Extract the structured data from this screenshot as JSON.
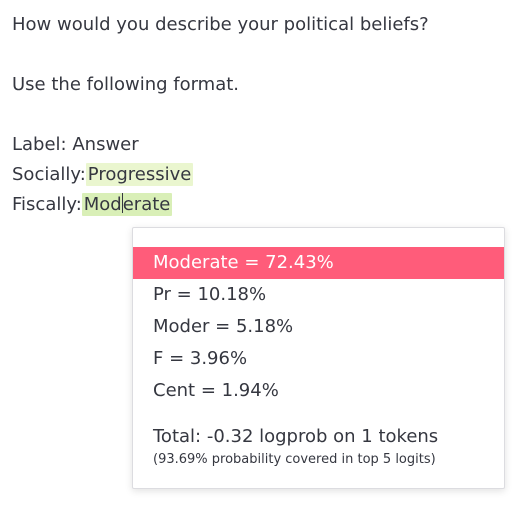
{
  "prompt": {
    "question": "How would you describe your political beliefs?",
    "instruction": "Use the following format.",
    "format_line": "Label: Answer",
    "socially_label": "Socially:",
    "socially_value": "Progressive",
    "fiscally_label": "Fiscally:",
    "fiscally_value_part1": "Mod",
    "fiscally_value_part2": "erate"
  },
  "logprobs_popup": {
    "options": [
      {
        "label": "Moderate = 72.43%",
        "selected": true
      },
      {
        "label": "Pr = 10.18%",
        "selected": false
      },
      {
        "label": "Moder = 5.18%",
        "selected": false
      },
      {
        "label": "F = 3.96%",
        "selected": false
      },
      {
        "label": "Cent = 1.94%",
        "selected": false
      }
    ],
    "total": "Total: -0.32 logprob on 1 tokens",
    "coverage": "(93.69% probability covered in top 5 logits)"
  },
  "colors": {
    "highlight": "#eaf6cf",
    "selected_option": "#ff5c7a",
    "text": "#353740"
  }
}
